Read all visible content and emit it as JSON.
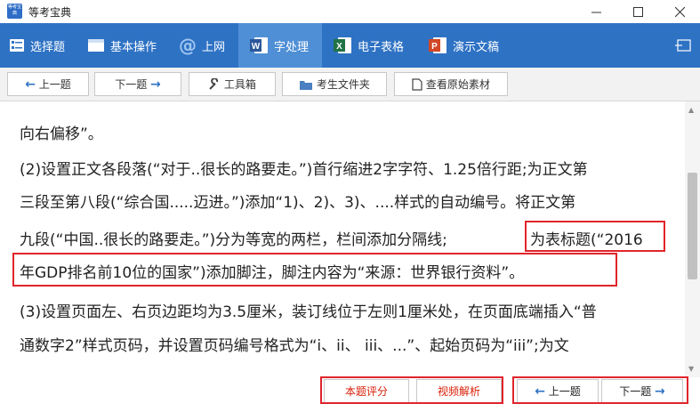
{
  "window": {
    "title": "等考宝典",
    "icon_text": "等考宝典",
    "min_icon": "minimize-icon",
    "max_icon": "maximize-icon",
    "close_icon": "close-icon"
  },
  "menu": {
    "items": [
      {
        "label": "选择题",
        "icon": "list-icon"
      },
      {
        "label": "基本操作",
        "icon": "window-icon"
      },
      {
        "label": "上网",
        "icon": "at-icon"
      },
      {
        "label": "字处理",
        "icon": "word-icon",
        "icon_letter": "W"
      },
      {
        "label": "电子表格",
        "icon": "excel-icon",
        "icon_letter": "X"
      },
      {
        "label": "演示文稿",
        "icon": "powerpoint-icon",
        "icon_letter": "P"
      }
    ],
    "active_index": 3,
    "pin_icon": "pin-icon"
  },
  "toolbar": {
    "prev_label": "上一题",
    "next_label": "下一题",
    "tools_label": "工具箱",
    "folder_label": "考生文件夹",
    "source_label": "查看原始素材"
  },
  "content": {
    "lines": [
      "向右偏移”。",
      "(2)设置正文各段落(“对于..很长的路要走。”)首行缩进2字字符、1.25倍行距;为正文第",
      "三段至第八段(“综合国.....迈进。”)添加“1)、2)、3)、....样式的自动编号。将正文第",
      "九段(“中国..很长的路要走。”)分为等宽的两栏，栏间添加分隔线;",
      "为表标题(“2016",
      "年GDP排名前10位的国家”)添加脚注，脚注内容为“来源：世界银行资料”。",
      "(3)设置页面左、右页边距均为3.5厘米，装订线位于左则1厘米处，在页面底端插入“普",
      "通数字2”样式页码，并设置页码编号格式为“i、ii、 iii、...”、起始页码为“iii”;为文"
    ],
    "highlight_color": "#e0252c"
  },
  "bottom": {
    "score_label": "本题评分",
    "video_label": "视频解析",
    "prev_label": "上一题",
    "next_label": "下一题"
  },
  "colors": {
    "menubar": "#2e72c4",
    "menu_active": "#4f8fd6",
    "accent_red": "#d81e06"
  }
}
